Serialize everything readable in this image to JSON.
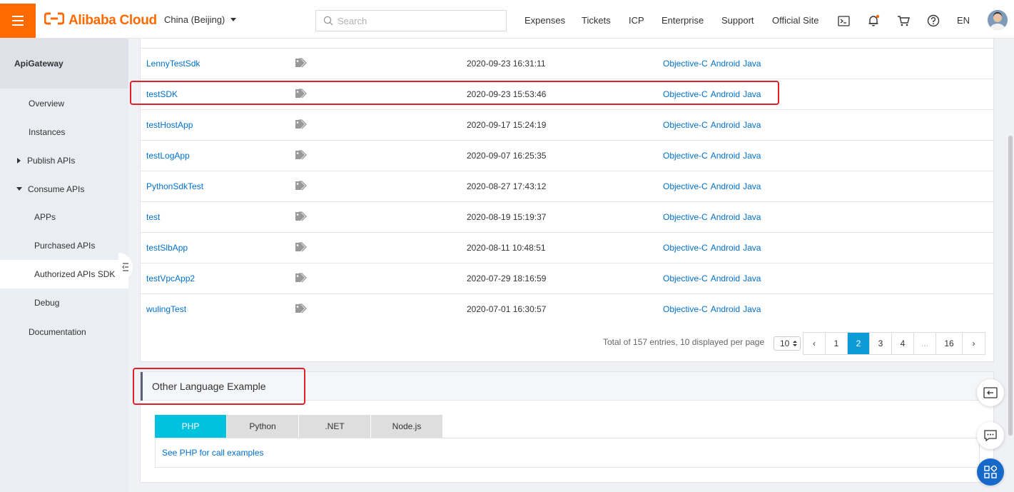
{
  "header": {
    "brand": "Alibaba Cloud",
    "region": "China (Beijing)",
    "search_placeholder": "Search",
    "nav": [
      "Expenses",
      "Tickets",
      "ICP",
      "Enterprise",
      "Support",
      "Official Site"
    ],
    "language": "EN",
    "notification_dot_color": "#ff6a00"
  },
  "sidebar": {
    "title": "ApiGateway",
    "items": {
      "overview": "Overview",
      "instances": "Instances",
      "publish_apis": "Publish APIs",
      "consume_apis": "Consume APIs",
      "apps": "APPs",
      "purchased_apis": "Purchased APIs",
      "authorized_apis_sdk": "Authorized APIs SDK",
      "debug": "Debug",
      "documentation": "Documentation"
    },
    "active_item": "Authorized APIs SDK"
  },
  "table": {
    "rows": [
      {
        "name": "LennyTestSdk",
        "time": "2020-09-23 16:31:11",
        "sdk": [
          "Objective-C",
          "Android",
          "Java"
        ]
      },
      {
        "name": "testSDK",
        "time": "2020-09-23 15:53:46",
        "sdk": [
          "Objective-C",
          "Android",
          "Java"
        ]
      },
      {
        "name": "testHostApp",
        "time": "2020-09-17 15:24:19",
        "sdk": [
          "Objective-C",
          "Android",
          "Java"
        ]
      },
      {
        "name": "testLogApp",
        "time": "2020-09-07 16:25:35",
        "sdk": [
          "Objective-C",
          "Android",
          "Java"
        ]
      },
      {
        "name": "PythonSdkTest",
        "time": "2020-08-27 17:43:12",
        "sdk": [
          "Objective-C",
          "Android",
          "Java"
        ]
      },
      {
        "name": "test",
        "time": "2020-08-19 15:19:37",
        "sdk": [
          "Objective-C",
          "Android",
          "Java"
        ]
      },
      {
        "name": "testSlbApp",
        "time": "2020-08-11 10:48:51",
        "sdk": [
          "Objective-C",
          "Android",
          "Java"
        ]
      },
      {
        "name": "testVpcApp2",
        "time": "2020-07-29 18:16:59",
        "sdk": [
          "Objective-C",
          "Android",
          "Java"
        ]
      },
      {
        "name": "wulingTest",
        "time": "2020-07-01 16:30:57",
        "sdk": [
          "Objective-C",
          "Android",
          "Java"
        ]
      }
    ]
  },
  "pagination": {
    "total_text": "Total of 157 entries, 10 displayed per page",
    "page_size": "10",
    "prev": "‹",
    "next": "›",
    "pages": [
      "1",
      "2",
      "3",
      "4",
      "...",
      "16"
    ],
    "current_page": "2"
  },
  "language_example": {
    "title": "Other Language Example",
    "tabs": [
      "PHP",
      "Python",
      ".NET",
      "Node.js"
    ],
    "active_tab": "PHP",
    "link_text": "See PHP for call examples"
  },
  "colors": {
    "brand_orange": "#ff6a00",
    "link_blue": "#0070cc",
    "active_page_blue": "#0d9bd8",
    "active_tab_cyan": "#00c1de",
    "highlight_red": "#e0202a"
  }
}
